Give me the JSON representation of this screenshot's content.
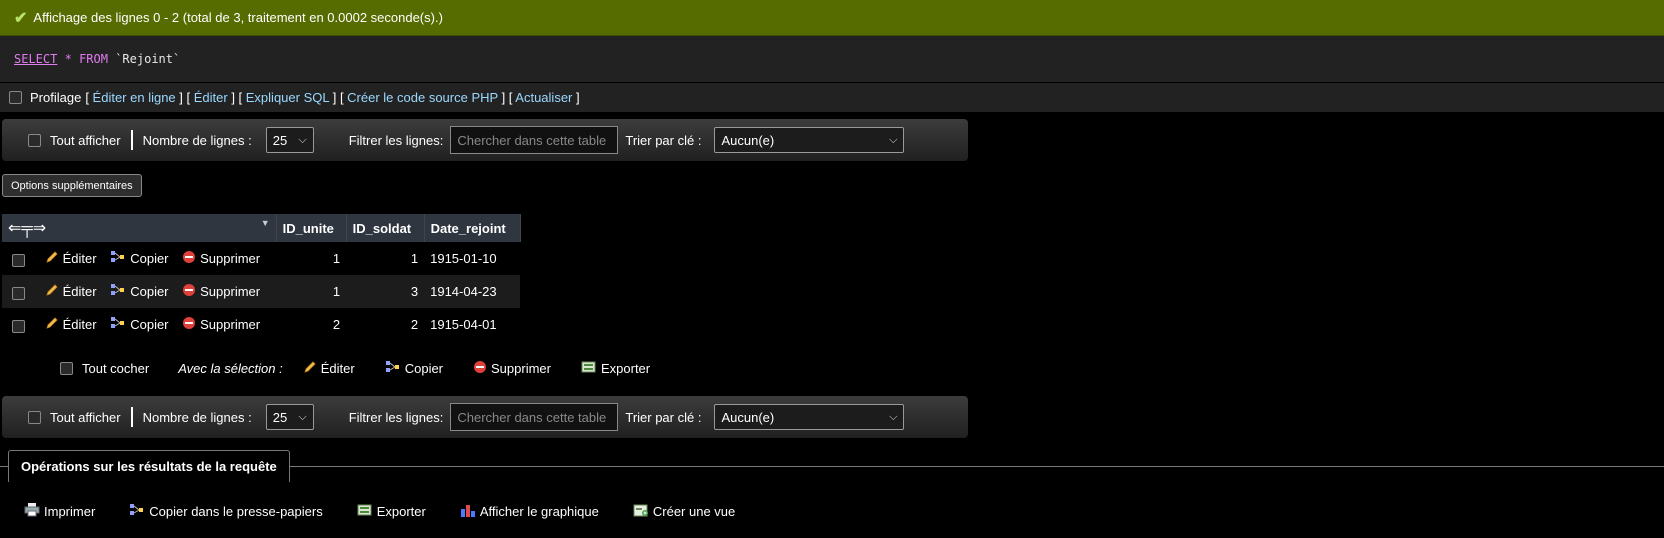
{
  "banner": {
    "text": "Affichage des lignes 0 - 2 (total de 3, traitement en 0.0002 seconde(s).)"
  },
  "sql": {
    "select": "SELECT",
    "star": "*",
    "from": "FROM",
    "table": "`Rejoint`"
  },
  "profiling": {
    "label": "Profilage",
    "links": [
      "Éditer en ligne",
      "Éditer",
      "Expliquer SQL",
      "Créer le code source PHP",
      "Actualiser"
    ]
  },
  "nav": {
    "show_all": "Tout afficher",
    "rows_label": "Nombre de lignes :",
    "rows_value": "25",
    "filter_label": "Filtrer les lignes:",
    "filter_placeholder": "Chercher dans cette table",
    "sort_label": "Trier par clé :",
    "sort_value": "Aucun(e)"
  },
  "extra_options": "Options supplémentaires",
  "table": {
    "columns": [
      "ID_unite",
      "ID_soldat",
      "Date_rejoint"
    ],
    "action_labels": {
      "edit": "Éditer",
      "copy": "Copier",
      "delete": "Supprimer"
    },
    "rows": [
      {
        "ID_unite": "1",
        "ID_soldat": "1",
        "Date_rejoint": "1915-01-10"
      },
      {
        "ID_unite": "1",
        "ID_soldat": "3",
        "Date_rejoint": "1914-04-23"
      },
      {
        "ID_unite": "2",
        "ID_soldat": "2",
        "Date_rejoint": "1915-04-01"
      }
    ]
  },
  "bulk": {
    "check_all": "Tout cocher",
    "with_selection": "Avec la sélection :",
    "edit": "Éditer",
    "copy": "Copier",
    "delete": "Supprimer",
    "export": "Exporter"
  },
  "operations": {
    "title": "Opérations sur les résultats de la requête",
    "print": "Imprimer",
    "copy_clipboard": "Copier dans le presse-papiers",
    "export": "Exporter",
    "chart": "Afficher le graphique",
    "create_view": "Créer une vue"
  }
}
